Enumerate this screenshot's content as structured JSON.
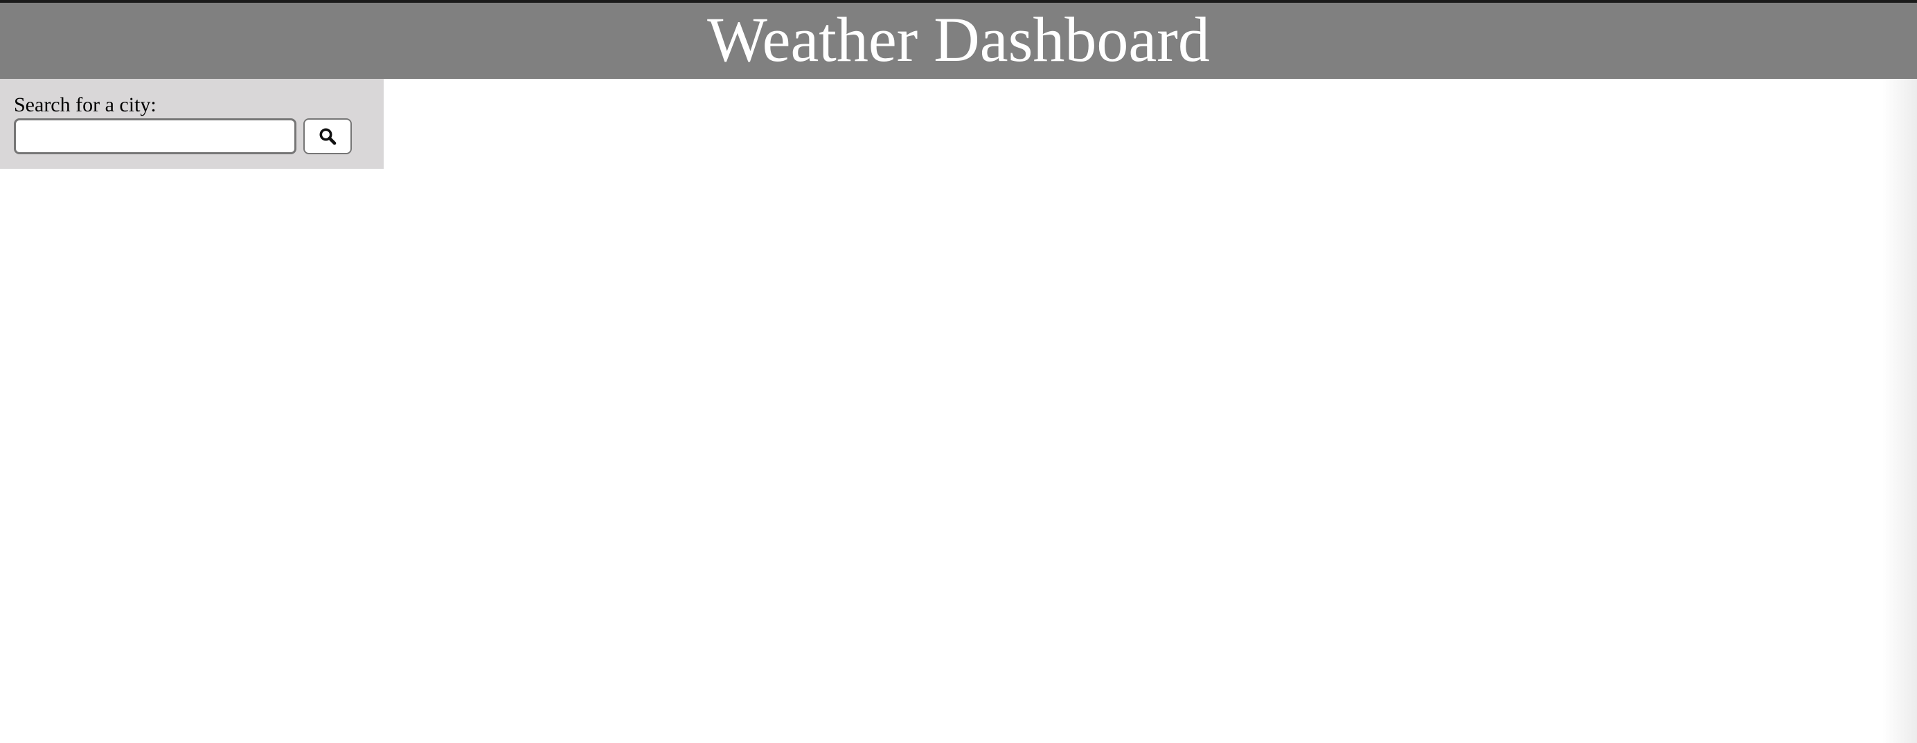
{
  "header": {
    "title": "Weather Dashboard"
  },
  "search": {
    "label": "Search for a city:",
    "value": "",
    "placeholder": "",
    "button_icon": "search-icon"
  },
  "colors": {
    "header_bg": "#808080",
    "header_text": "#ffffff",
    "sidebar_bg": "#d9d7d8",
    "page_bg": "#ffffff"
  }
}
